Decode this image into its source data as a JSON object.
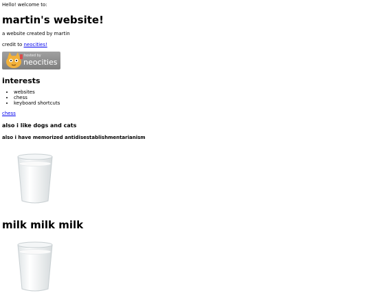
{
  "greeting": "Hello! welcome to:",
  "title": "martin's website!",
  "subtitle": "a website created by martin",
  "credit": {
    "prefix": "credit to ",
    "link": "neocities!"
  },
  "badge": {
    "line1": "hosted by",
    "line2": "neocities"
  },
  "interests": {
    "heading": "interests",
    "items": [
      "websites",
      "chess",
      "keyboard shortcuts"
    ]
  },
  "chess_link": "chess",
  "dogs_cats": "also i like dogs and cats",
  "memorized": "also i have memorized antidisestablishmentarianism",
  "milk_heading": "milk milk milk"
}
